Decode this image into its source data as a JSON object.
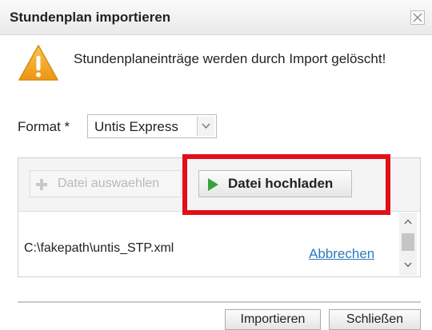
{
  "dialog": {
    "title": "Stundenplan importieren",
    "close_icon": "close-icon"
  },
  "warning": {
    "icon": "warning-triangle-icon",
    "message": "Stundenplaneinträge werden durch Import gelöscht!",
    "icon_color": "#f0a81c"
  },
  "format": {
    "label": "Format *",
    "selected": "Untis Express",
    "arrow_icon": "chevron-down-icon"
  },
  "upload": {
    "choose_label": "Datei auswaehlen",
    "choose_icon": "plus-icon",
    "upload_label": "Datei hochladen",
    "upload_icon": "play-icon",
    "upload_icon_color": "#3aa23a",
    "highlight_color": "#e11016",
    "file_path": "C:\\fakepath\\untis_STP.xml",
    "cancel_label": "Abbrechen"
  },
  "footer": {
    "import_label": "Importieren",
    "close_label": "Schließen"
  }
}
